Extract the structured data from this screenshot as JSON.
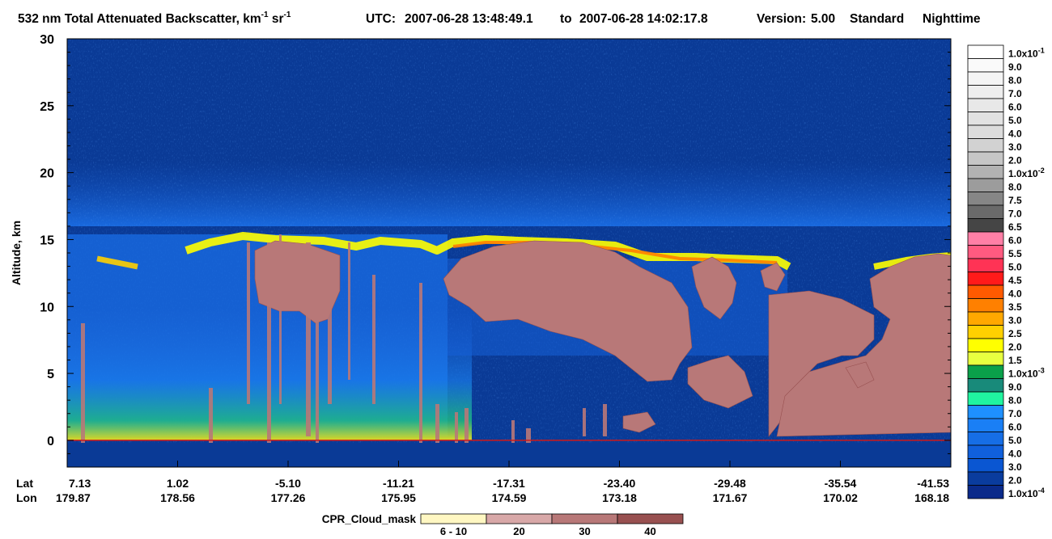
{
  "chart_data": {
    "type": "heatmap",
    "title": {
      "text": "532 nm Total Attenuated Backscatter, km",
      "unit_sup1": "-1",
      "unit_mid": " sr",
      "unit_sup2": "-1",
      "utc_label": "UTC:",
      "utc_start": "2007-06-28 13:48:49.1",
      "to_word": "to",
      "utc_end": "2007-06-28 14:02:17.8",
      "version_label": "Version:",
      "version": "5.00",
      "mode": "Standard",
      "time_of_day": "Nighttime"
    },
    "ylabel": "Altitude, km",
    "ylim": [
      -2,
      30
    ],
    "y_ticks": [
      0,
      5,
      10,
      15,
      20,
      25,
      30
    ],
    "x_axis": {
      "row_labels": [
        "Lat",
        "Lon"
      ],
      "lat": [
        "7.13",
        "1.02",
        "-5.10",
        "-11.21",
        "-17.31",
        "-23.40",
        "-29.48",
        "-35.54",
        "-41.53"
      ],
      "lon": [
        "179.87",
        "178.56",
        "177.26",
        "175.95",
        "174.59",
        "173.18",
        "171.67",
        "170.02",
        "168.18"
      ]
    },
    "surface_line_altitude_km": 0,
    "colorbar": {
      "levels": [
        {
          "label": "1.0x10",
          "sup": "-1",
          "color": "#ffffff"
        },
        {
          "label": "9.0",
          "color": "#fafafa"
        },
        {
          "label": "8.0",
          "color": "#f4f4f4"
        },
        {
          "label": "7.0",
          "color": "#eeeeee"
        },
        {
          "label": "6.0",
          "color": "#e8e8e8"
        },
        {
          "label": "5.0",
          "color": "#e2e2e2"
        },
        {
          "label": "4.0",
          "color": "#dcdcdc"
        },
        {
          "label": "3.0",
          "color": "#d2d2d2"
        },
        {
          "label": "2.0",
          "color": "#c6c6c6"
        },
        {
          "label": "1.0x10",
          "sup": "-2",
          "color": "#b2b2b2"
        },
        {
          "label": "8.0",
          "color": "#9c9c9c"
        },
        {
          "label": "7.5",
          "color": "#868686"
        },
        {
          "label": "7.0",
          "color": "#6a6a6a"
        },
        {
          "label": "6.5",
          "color": "#454545"
        },
        {
          "label": "6.0",
          "color": "#ff7fa6"
        },
        {
          "label": "5.5",
          "color": "#ff5a80"
        },
        {
          "label": "5.0",
          "color": "#ff3355"
        },
        {
          "label": "4.5",
          "color": "#ff1a1a"
        },
        {
          "label": "4.0",
          "color": "#ff5a00"
        },
        {
          "label": "3.5",
          "color": "#ff8000"
        },
        {
          "label": "3.0",
          "color": "#ffa800"
        },
        {
          "label": "2.5",
          "color": "#ffd000"
        },
        {
          "label": "2.0",
          "color": "#ffff00"
        },
        {
          "label": "1.5",
          "color": "#e8ff40"
        },
        {
          "label": "1.0x10",
          "sup": "-3",
          "color": "#0aa04a"
        },
        {
          "label": "9.0",
          "color": "#188a7a"
        },
        {
          "label": "8.0",
          "color": "#20f5a0"
        },
        {
          "label": "7.0",
          "color": "#1e90ff"
        },
        {
          "label": "6.0",
          "color": "#1a7ff5"
        },
        {
          "label": "5.0",
          "color": "#166ee6"
        },
        {
          "label": "4.0",
          "color": "#1060dc"
        },
        {
          "label": "3.0",
          "color": "#0a56d2"
        },
        {
          "label": "2.0",
          "color": "#0a3c9e"
        },
        {
          "label": "1.0x10",
          "sup": "-4",
          "color": "#0a2a8a"
        }
      ]
    },
    "cpr_legend": {
      "title": "CPR_Cloud_mask",
      "bins": [
        {
          "label": "6 - 10",
          "color": "#fff7c2"
        },
        {
          "label": "20",
          "color": "#d8a8a8"
        },
        {
          "label": "30",
          "color": "#b87878"
        },
        {
          "label": "40",
          "color": "#985050"
        }
      ]
    },
    "background_color": "#0a3a96",
    "surface_line_color": "#d01818"
  }
}
